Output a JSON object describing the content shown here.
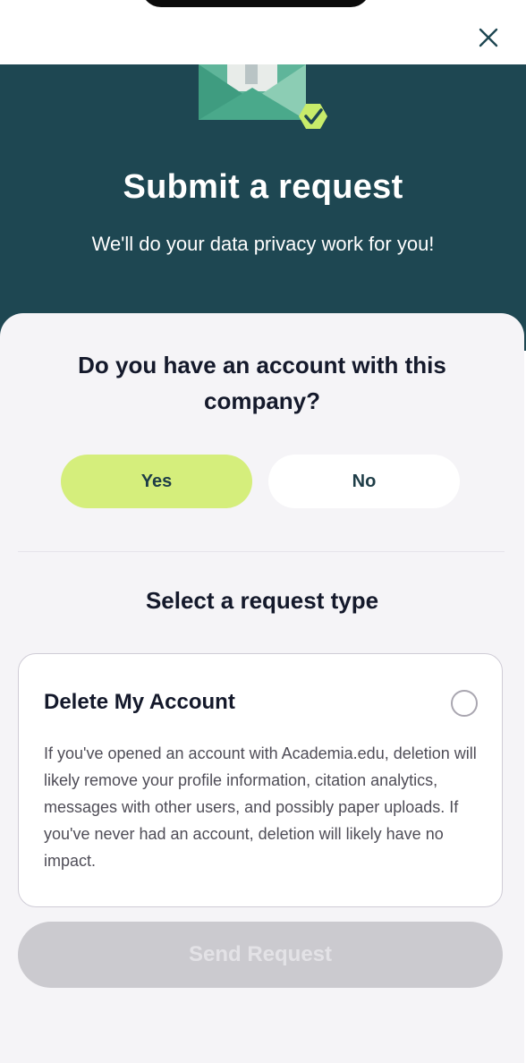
{
  "header": {
    "close_icon": "close-icon"
  },
  "hero": {
    "title": "Submit a request",
    "subtitle": "We'll do your data privacy work for you!",
    "illustration_icon": "envelope-check-icon"
  },
  "account_question": {
    "question": "Do you have an account with this company?",
    "options": [
      {
        "label": "Yes",
        "selected": true
      },
      {
        "label": "No",
        "selected": false
      }
    ]
  },
  "request_type": {
    "title": "Select a request type",
    "options": [
      {
        "title": "Delete My Account",
        "description": "If you've opened an account with Academia.edu, deletion will likely remove your profile information, citation analytics, messages with other users, and possibly paper uploads. If you've never had an account, deletion will likely have no impact.",
        "selected": false
      }
    ]
  },
  "actions": {
    "send_label": "Send Request",
    "send_enabled": false
  },
  "colors": {
    "hero_bg": "#1e4752",
    "accent_green": "#d5ee7c",
    "sheet_bg": "#f5f4f7",
    "disabled_button": "#cbcacf"
  }
}
